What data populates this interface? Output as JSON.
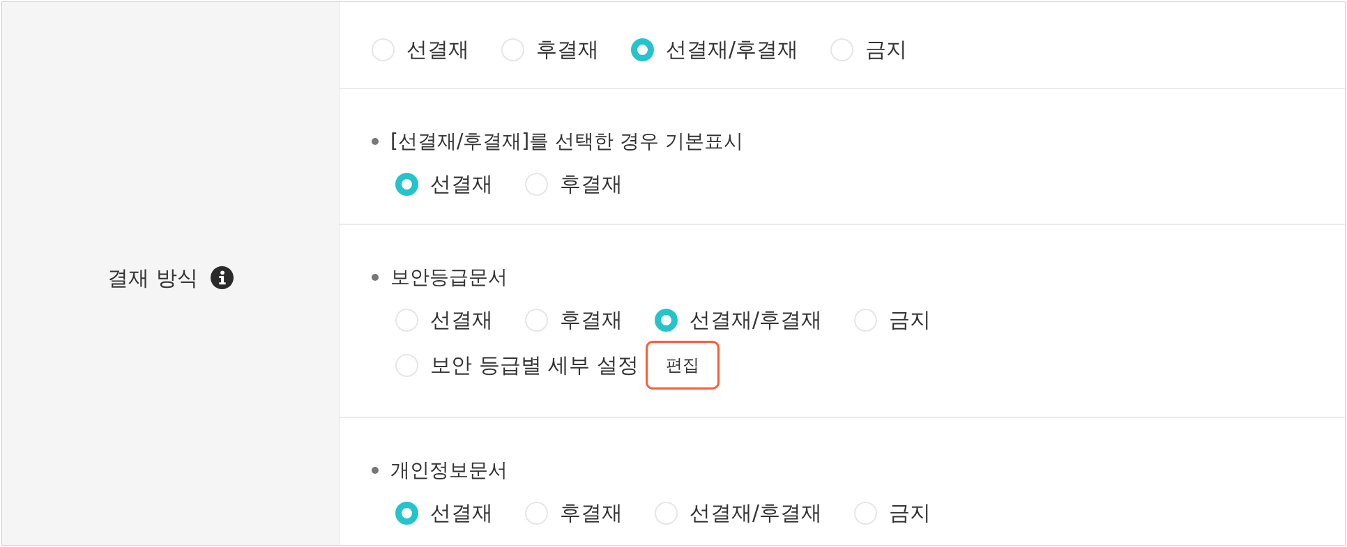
{
  "setting": {
    "label": "결재 방식"
  },
  "options": [
    {
      "label": "선결재",
      "selected": false
    },
    {
      "label": "후결재",
      "selected": false
    },
    {
      "label": "선결재/후결재",
      "selected": true
    },
    {
      "label": "금지",
      "selected": false
    }
  ],
  "sections": [
    {
      "title": "[선결재/후결재]를 선택한 경우 기본표시",
      "options": [
        {
          "label": "선결재",
          "selected": true
        },
        {
          "label": "후결재",
          "selected": false
        }
      ]
    },
    {
      "title": "보안등급문서",
      "options": [
        {
          "label": "선결재",
          "selected": false
        },
        {
          "label": "후결재",
          "selected": false
        },
        {
          "label": "선결재/후결재",
          "selected": true
        },
        {
          "label": "금지",
          "selected": false
        }
      ],
      "detail_option": {
        "label": "보안 등급별 세부 설정",
        "selected": false,
        "button": {
          "label": "편집",
          "highlighted": true
        }
      }
    },
    {
      "title": "개인정보문서",
      "options": [
        {
          "label": "선결재",
          "selected": true
        },
        {
          "label": "후결재",
          "selected": false
        },
        {
          "label": "선결재/후결재",
          "selected": false
        },
        {
          "label": "금지",
          "selected": false
        }
      ]
    }
  ]
}
